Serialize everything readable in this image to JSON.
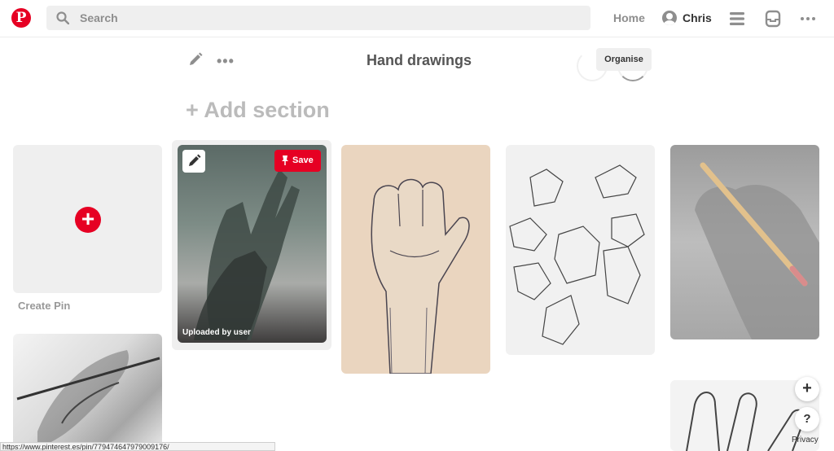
{
  "header": {
    "logo_letter": "P",
    "search_placeholder": "Search",
    "home_label": "Home",
    "user_name": "Chris"
  },
  "board": {
    "title": "Hand drawings",
    "organise_label": "Organise",
    "add_section_label": "+ Add section"
  },
  "pins": {
    "create_pin_label": "Create Pin",
    "save_label": "Save",
    "uploaded_by": "Uploaded by user"
  },
  "floating": {
    "add_label": "+",
    "help_label": "?",
    "privacy_label": "Privacy"
  },
  "status_bar": {
    "url": "https://www.pinterest.es/pin/779474647979009176/"
  },
  "colors": {
    "brand": "#e60023",
    "search_bg": "#efefef"
  }
}
